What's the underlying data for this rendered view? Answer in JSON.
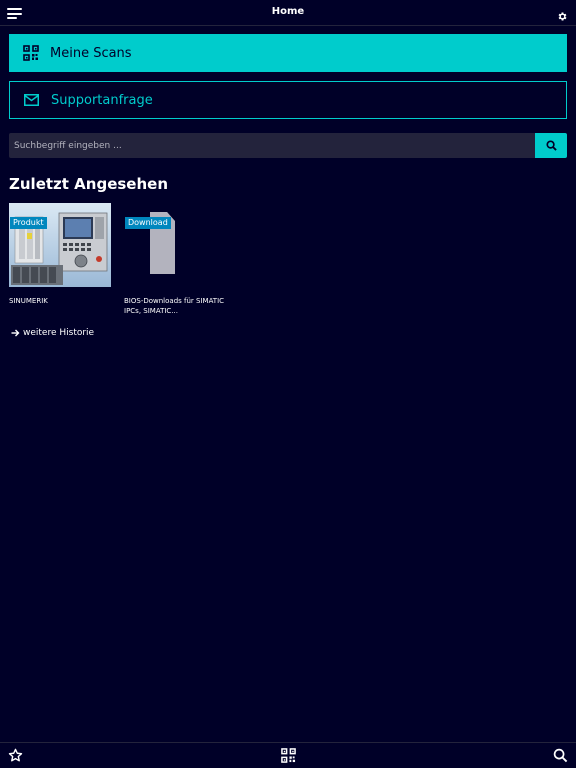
{
  "header": {
    "title": "Home"
  },
  "tiles": {
    "scans_label": "Meine Scans",
    "support_label": "Supportanfrage"
  },
  "search": {
    "placeholder": "Suchbegriff eingeben ..."
  },
  "recent": {
    "title": "Zuletzt Angesehen",
    "items": [
      {
        "badge": "Produkt",
        "title": "SINUMERIK"
      },
      {
        "badge": "Download",
        "title": "BIOS-Downloads für SIMATIC IPCs, SIMATIC..."
      }
    ],
    "more_link": "weitere Historie"
  },
  "colors": {
    "background": "#000028",
    "accent": "#00cccc",
    "badge": "#0087be",
    "input": "#23233c"
  },
  "icons": {
    "menu": "hamburger-icon",
    "settings": "gear-icon",
    "scans": "qr-code-icon",
    "support": "envelope-icon",
    "search": "search-icon",
    "favorites": "star-icon",
    "scan": "qr-code-icon"
  }
}
